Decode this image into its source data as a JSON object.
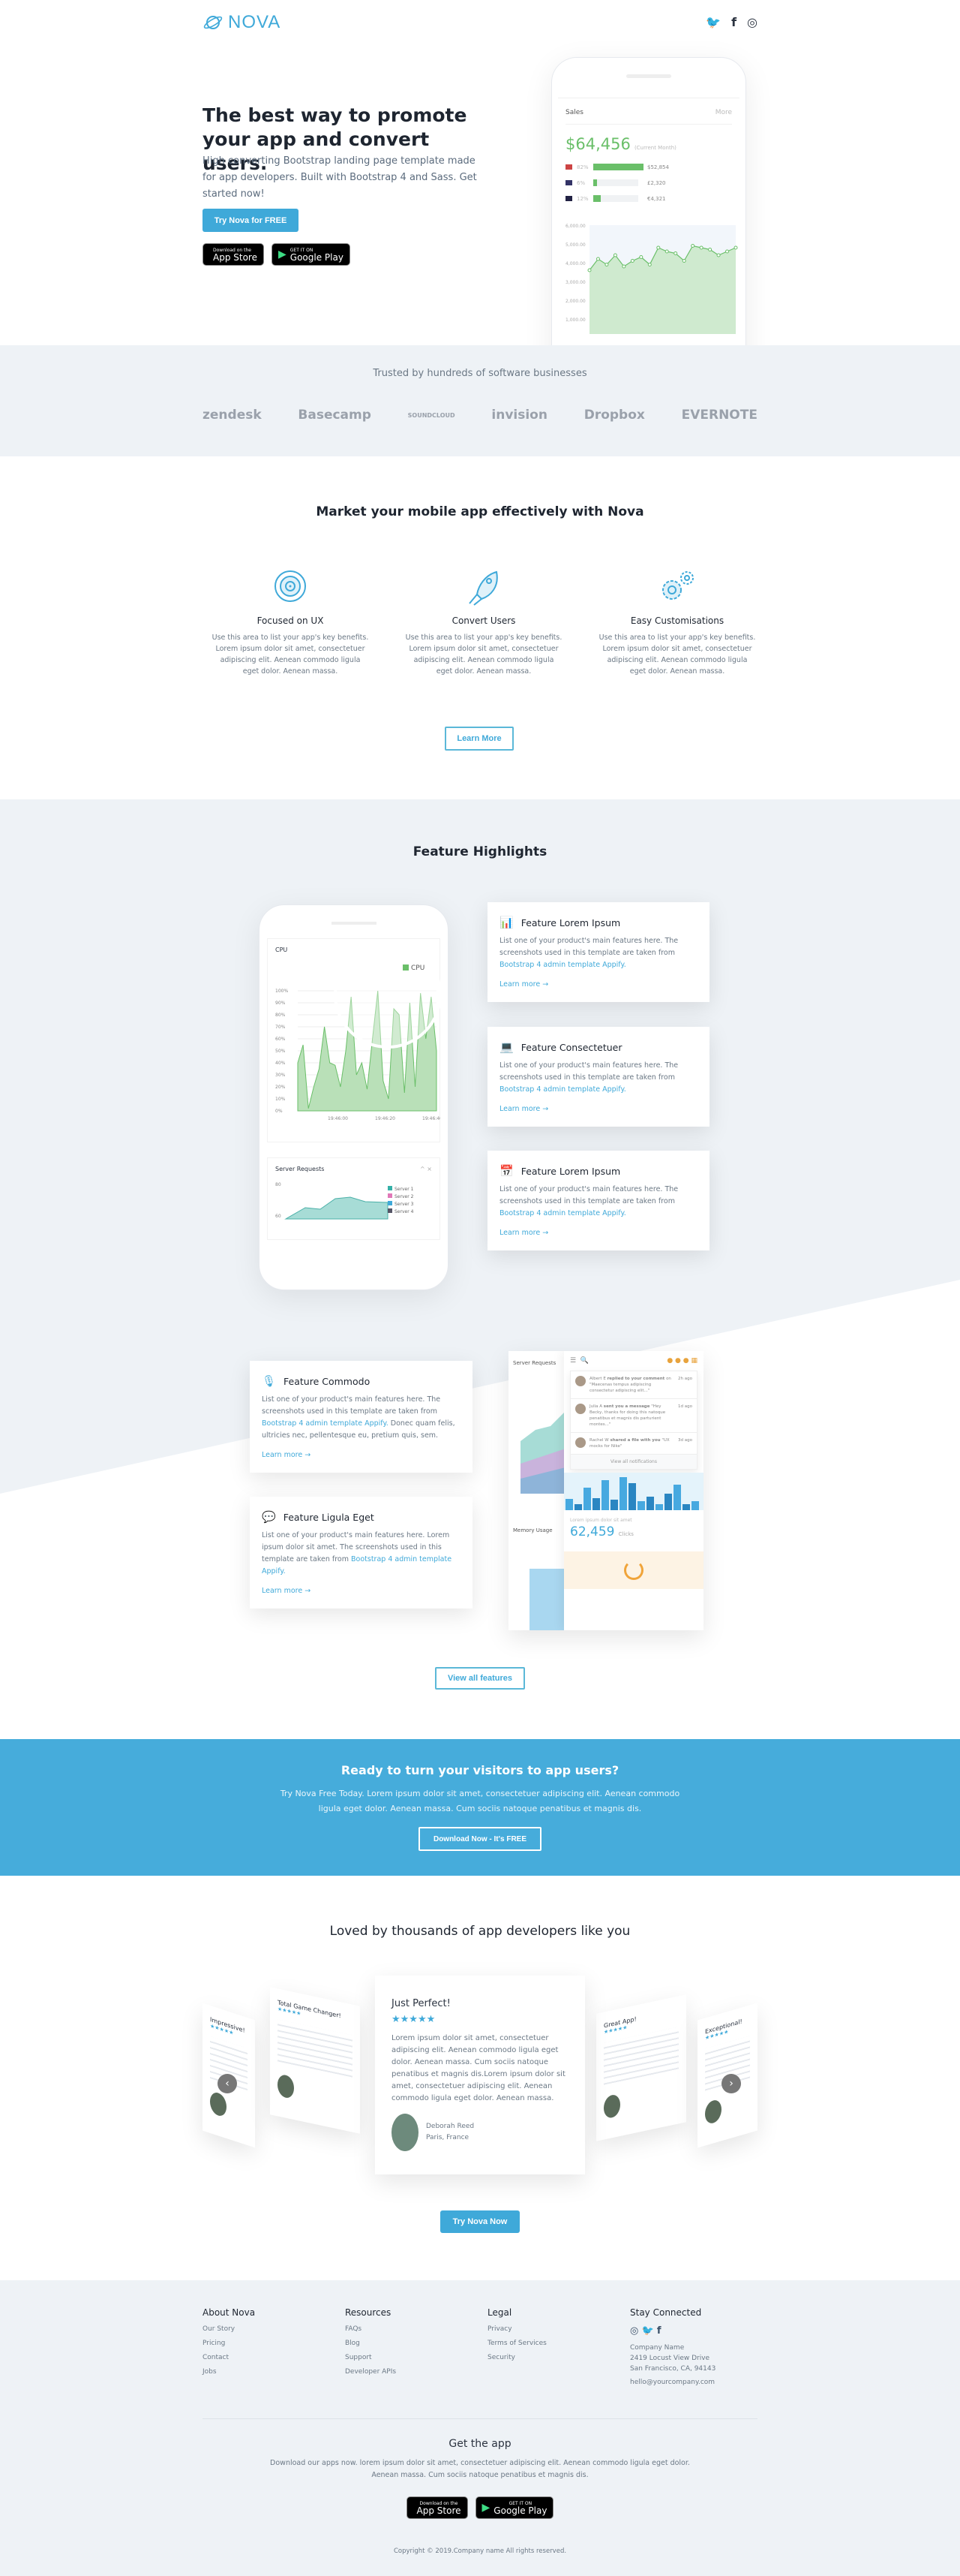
{
  "nav": {
    "brand": "NOVA",
    "social": [
      {
        "icon": "twitter-icon",
        "glyph": "🐦"
      },
      {
        "icon": "facebook-icon",
        "glyph": "f"
      },
      {
        "icon": "instagram-icon",
        "glyph": "◎"
      }
    ]
  },
  "hero": {
    "title": "The best way to promote your app and convert users.",
    "lead": "High converting Bootstrap landing page template made for app developers. Built with Bootstrap 4 and Sass. Get started now!",
    "cta": "Try Nova for FREE",
    "appstore": {
      "small": "Download on the",
      "large": "App Store"
    },
    "googleplay": {
      "small": "GET IT ON",
      "large": "Google Play"
    },
    "mockup": {
      "title": "Sales",
      "more": "More",
      "amount": "$64,456",
      "amount_note": "(Current Month)",
      "rows": [
        {
          "pct": "82%",
          "value": "$52,854",
          "fill": 82
        },
        {
          "pct": "6%",
          "value": "£2,320",
          "fill": 6
        },
        {
          "pct": "12%",
          "value": "€4,321",
          "fill": 12
        }
      ],
      "y_ticks": [
        "6,000.00",
        "5,000.00",
        "4,000.00",
        "3,000.00",
        "2,000.00",
        "1,000.00"
      ],
      "accent": "#6abf69"
    }
  },
  "trusted": {
    "title": "Trusted by hundreds of software businesses",
    "logos": [
      "zendesk",
      "Basecamp",
      "SOUNDCLOUD",
      "invision",
      "Dropbox",
      "EVERNOTE"
    ]
  },
  "market": {
    "title": "Market your mobile app effectively with Nova",
    "features": [
      {
        "icon": "target-icon",
        "title": "Focused on UX",
        "text": "Use this area to list your app's key benefits. Lorem ipsum dolor sit amet, consectetuer adipiscing elit. Aenean commodo ligula eget dolor. Aenean massa."
      },
      {
        "icon": "rocket-icon",
        "title": "Convert Users",
        "text": "Use this area to list your app's key benefits. Lorem ipsum dolor sit amet, consectetuer adipiscing elit. Aenean commodo ligula eget dolor. Aenean massa."
      },
      {
        "icon": "gears-icon",
        "title": "Easy Customisations",
        "text": "Use this area to list your app's key benefits. Lorem ipsum dolor sit amet, consectetuer adipiscing elit. Aenean commodo ligula eget dolor. Aenean massa."
      }
    ],
    "button": "Learn More"
  },
  "highlights": {
    "title": "Feature Highlights",
    "phone": {
      "cpu_title": "CPU",
      "legend": "CPU",
      "y_ticks": [
        "100%",
        "90%",
        "80%",
        "70%",
        "60%",
        "50%",
        "40%",
        "30%",
        "20%",
        "10%",
        "0%"
      ],
      "x_ticks": [
        "19:46:00",
        "19:46:20",
        "19:46:40"
      ],
      "server_title": "Server Requests",
      "server_legend": [
        "Server 1",
        "Server 2",
        "Server 3",
        "Server 4"
      ],
      "server_y": [
        "80",
        "60"
      ]
    },
    "cards": [
      {
        "icon": "bar-chart-icon",
        "title": "Feature Lorem Ipsum",
        "text": "List one of your product's main features here. The screenshots used in this template are taken from ",
        "link": "Bootstrap 4 admin template Appify.",
        "tail": "",
        "more": "Learn more →"
      },
      {
        "icon": "laptop-code-icon",
        "title": "Feature Consectetuer",
        "text": "List one of your product's main features here. The screenshots used in this template are taken from ",
        "link": "Bootstrap 4 admin template Appify.",
        "tail": "",
        "more": "Learn more →"
      },
      {
        "icon": "calendar-icon",
        "title": "Feature Lorem Ipsum",
        "text": "List one of your product's main features here. The screenshots used in this template are taken from ",
        "link": "Bootstrap 4 admin template Appify.",
        "tail": "",
        "more": "Learn more →"
      },
      {
        "icon": "microphone-icon",
        "title": "Feature Commodo",
        "text": "List one of your product's main features here. The screenshots used in this template are taken from ",
        "link": "Bootstrap 4 admin template Appify.",
        "tail": " Donec quam felis, ultricies nec, pellentesque eu, pretium quis, sem.",
        "more": "Learn more →"
      },
      {
        "icon": "chat-icon",
        "title": "Feature Ligula Eget",
        "text": "List one of your product's main features here. Lorem ipsum dolor sit amet. The screenshots used in this template are taken from ",
        "link": "Bootstrap 4 admin template Appify.",
        "tail": "",
        "more": "Learn more →"
      }
    ],
    "dashboard": {
      "server_title": "Server Requests",
      "memory_title": "Memory Usage",
      "notifications": [
        {
          "name": "Albert E",
          "action": "replied to your comment",
          "text": "on \"Maecenas tempus adipiscing consectetur adipiscing elit...\"",
          "time": "2h ago"
        },
        {
          "name": "Julia A",
          "action": "sent you a message",
          "text": "\"Hey Becky, thanks for doing this natoque penatibus et magnis dis parturient montes...\"",
          "time": "1d ago"
        },
        {
          "name": "Rachel W",
          "action": "shared a file with you",
          "text": "\"UX mocks for Nike\"",
          "time": "3d ago"
        }
      ],
      "view_all": "View all notifications",
      "clicks": "62,459",
      "clicks_label": "Clicks",
      "clicks_sub": "Lorem ipsum dolor sit amet"
    },
    "button": "View all features"
  },
  "cta": {
    "title": "Ready to turn your visitors to app users?",
    "text": "Try Nova Free Today. Lorem ipsum dolor sit amet, consectetuer adipiscing elit. Aenean commodo ligula eget dolor. Aenean massa. Cum sociis natoque penatibus et magnis dis.",
    "button": "Download Now - It's FREE",
    "color": "#46acdb"
  },
  "testimonials": {
    "title": "Loved by thousands of app developers like you",
    "main": {
      "title": "Just Perfect!",
      "rating": 5,
      "text": "Lorem ipsum dolor sit amet, consectetuer adipiscing elit. Aenean commodo ligula eget dolor. Aenean massa. Cum sociis natoque penatibus et magnis dis.Lorem ipsum dolor sit amet, consectetuer adipiscing elit. Aenean commodo ligula eget dolor. Aenean massa.",
      "name": "Deborah Reed",
      "location": "Paris, France"
    },
    "side": [
      {
        "title": "Impressive!"
      },
      {
        "title": "Total Game Changer!"
      },
      {
        "title": "Great App!"
      },
      {
        "title": "Exceptional!"
      }
    ],
    "button": "Try Nova Now"
  },
  "footer": {
    "cols": [
      {
        "title": "About Nova",
        "links": [
          "Our Story",
          "Pricing",
          "Contact",
          "Jobs"
        ]
      },
      {
        "title": "Resources",
        "links": [
          "FAQs",
          "Blog",
          "Support",
          "Developer APIs"
        ]
      },
      {
        "title": "Legal",
        "links": [
          "Privacy",
          "Terms of Services",
          "Security"
        ]
      }
    ],
    "connect": {
      "title": "Stay Connected",
      "address": [
        "Company Name",
        "2419 Locust View Drive",
        "San Francisco, CA, 94143"
      ],
      "email": "hello@yourcompany.com"
    },
    "getapp": {
      "title": "Get the app",
      "text": "Download our apps now. lorem ipsum dolor sit amet, consectetuer adipiscing elit. Aenean commodo ligula eget dolor. Aenean massa. Cum sociis natoque penatibus et magnis dis."
    },
    "copyright": "Copyright © 2019.Company name All rights reserved."
  }
}
